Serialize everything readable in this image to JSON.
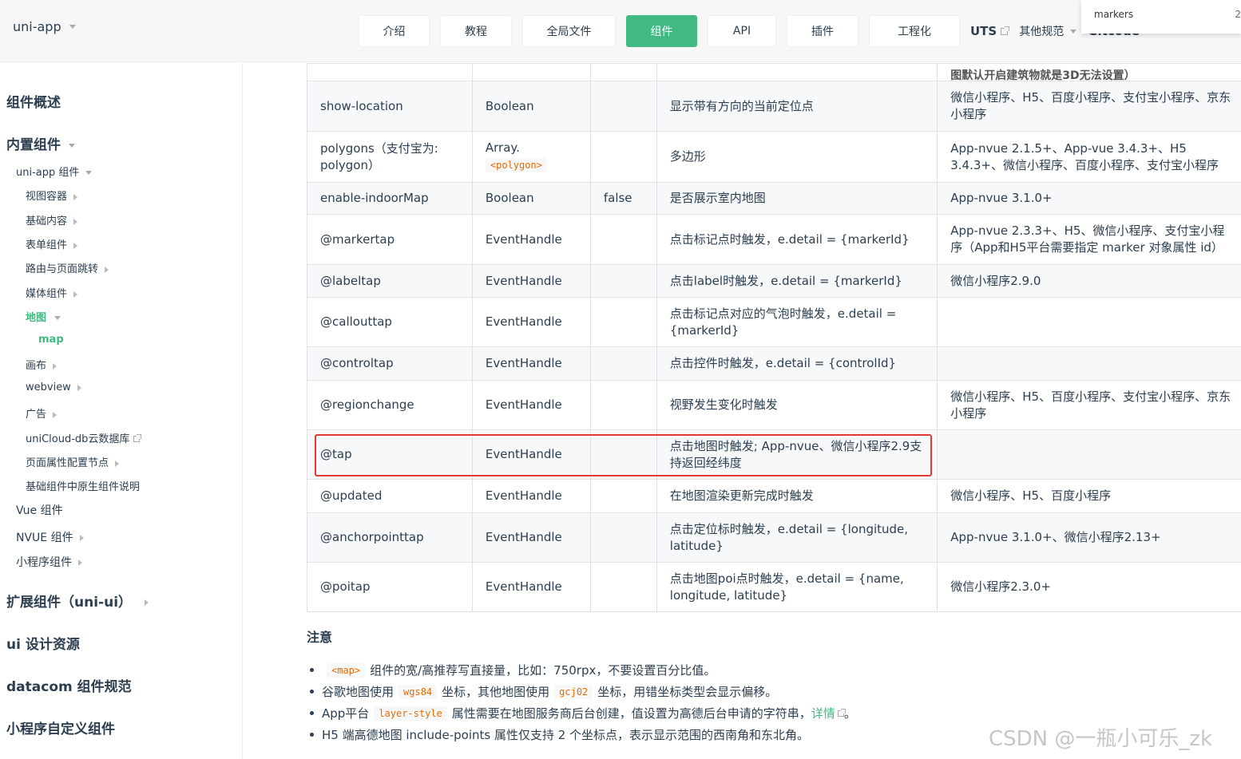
{
  "header": {
    "brand": "uni-app",
    "nav": [
      "介绍",
      "教程",
      "全局文件",
      "组件",
      "API",
      "插件",
      "工程化"
    ],
    "active_nav": "组件",
    "uts": "UTS",
    "other_spec": "其他规范",
    "cut_label": "Gitcode",
    "search_popup": {
      "text": "markers",
      "count": "2"
    }
  },
  "sidebar": {
    "overview": "组件概述",
    "builtin": "内置组件",
    "uniapp_components": "uni-app 组件",
    "view_container": "视图容器",
    "basic_content": "基础内容",
    "form_components": "表单组件",
    "routing": "路由与页面跳转",
    "media": "媒体组件",
    "map_group": "地图",
    "map_item": "map",
    "canvas": "画布",
    "webview": "webview",
    "ad": "广告",
    "unicloud_db": "uniCloud-db云数据库",
    "page_meta": "页面属性配置节点",
    "native_components": "基础组件中原生组件说明",
    "vue_components": "Vue 组件",
    "nvue_components": "NVUE 组件",
    "mp_components": "小程序组件",
    "extended": "扩展组件（uni-ui）",
    "ui_resources": "ui 设计资源",
    "datacom": "datacom 组件规范",
    "mp_custom": "小程序自定义组件"
  },
  "table": {
    "top_row_platform": "图默认开启建筑物就是3D无法设置）",
    "rows": [
      {
        "attr": "show-location",
        "type": "Boolean",
        "default": "",
        "desc": "显示带有方向的当前定位点",
        "platform": "微信小程序、H5、百度小程序、支付宝小程序、京东小程序"
      },
      {
        "attr": "polygons（支付宝为: polygon）",
        "type": "Array.",
        "type_code": "<polygon>",
        "default": "",
        "desc": "多边形",
        "platform": "App-nvue 2.1.5+、App-vue 3.4.3+、H5 3.4.3+、微信小程序、百度小程序、支付宝小程序"
      },
      {
        "attr": "enable-indoorMap",
        "type": "Boolean",
        "default": "false",
        "desc": "是否展示室内地图",
        "platform": "App-nvue 3.1.0+"
      },
      {
        "attr": "@markertap",
        "type": "EventHandle",
        "default": "",
        "desc": "点击标记点时触发，e.detail = {markerId}",
        "platform": "App-nvue 2.3.3+、H5、微信小程序、支付宝小程序（App和H5平台需要指定 marker 对象属性 id）"
      },
      {
        "attr": "@labeltap",
        "type": "EventHandle",
        "default": "",
        "desc": "点击label时触发，e.detail = {markerId}",
        "platform": "微信小程序2.9.0"
      },
      {
        "attr": "@callouttap",
        "type": "EventHandle",
        "default": "",
        "desc": "点击标记点对应的气泡时触发，e.detail = {markerId}",
        "platform": ""
      },
      {
        "attr": "@controltap",
        "type": "EventHandle",
        "default": "",
        "desc": "点击控件时触发，e.detail = {controlId}",
        "platform": ""
      },
      {
        "attr": "@regionchange",
        "type": "EventHandle",
        "default": "",
        "desc": "视野发生变化时触发",
        "platform": "微信小程序、H5、百度小程序、支付宝小程序、京东小程序"
      },
      {
        "attr": "@tap",
        "type": "EventHandle",
        "default": "",
        "desc": "点击地图时触发; App-nvue、微信小程序2.9支持返回经纬度",
        "platform": ""
      },
      {
        "attr": "@updated",
        "type": "EventHandle",
        "default": "",
        "desc": "在地图渲染更新完成时触发",
        "platform": "微信小程序、H5、百度小程序"
      },
      {
        "attr": "@anchorpointtap",
        "type": "EventHandle",
        "default": "",
        "desc": "点击定位标时触发，e.detail = {longitude, latitude}",
        "platform": "App-nvue 3.1.0+、微信小程序2.13+"
      },
      {
        "attr": "@poitap",
        "type": "EventHandle",
        "default": "",
        "desc": "点击地图poi点时触发，e.detail = {name, longitude, latitude}",
        "platform": "微信小程序2.3.0+"
      }
    ]
  },
  "notes": {
    "title": "注意",
    "n1_code": "<map>",
    "n1_text": "组件的宽/高推荐写直接量，比如：750rpx，不要设置百分比值。",
    "n2_a": "谷歌地图使用",
    "n2_code1": "wgs84",
    "n2_b": "坐标，其他地图使用",
    "n2_code2": "gcj02",
    "n2_c": "坐标，用错坐标类型会显示偏移。",
    "n3_a": "App平台",
    "n3_code": "layer-style",
    "n3_b": "属性需要在地图服务商后台创建，值设置为高德后台申请的字符串，",
    "n3_link": "详情",
    "n3_end": "。",
    "n4": "H5 端高德地图 include-points 属性仅支持 2 个坐标点，表示显示范围的西南角和东北角。"
  },
  "watermark": "CSDN @一瓶小可乐_zk"
}
